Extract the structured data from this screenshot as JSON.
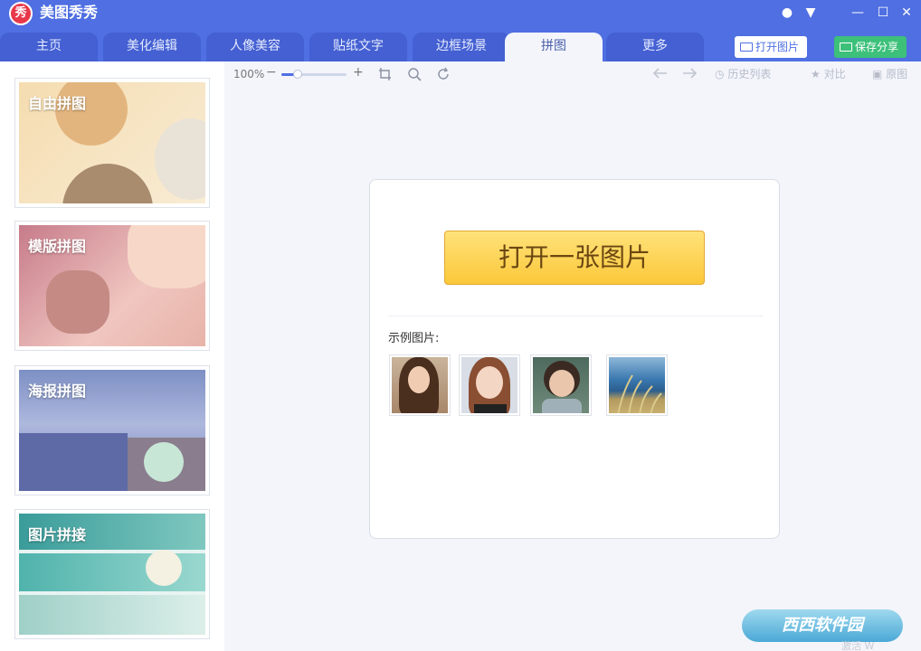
{
  "app": {
    "title": "美图秀秀",
    "logo_text": "秀"
  },
  "window_controls": {
    "chat": "●",
    "menu": "▼",
    "minimize": "—",
    "maximize": "☐",
    "close": "✕"
  },
  "tabs": [
    {
      "label": "主页"
    },
    {
      "label": "美化编辑"
    },
    {
      "label": "人像美容"
    },
    {
      "label": "贴纸文字"
    },
    {
      "label": "边框场景"
    },
    {
      "label": "拼图",
      "active": true
    },
    {
      "label": "更多"
    }
  ],
  "header_buttons": {
    "open_image": "打开图片",
    "save_share": "保存分享"
  },
  "sidebar": {
    "cards": [
      {
        "label": "自由拼图"
      },
      {
        "label": "模版拼图"
      },
      {
        "label": "海报拼图"
      },
      {
        "label": "图片拼接"
      }
    ]
  },
  "toolbar": {
    "zoom_level": "100%",
    "zoom_minus": "−",
    "zoom_plus": "+",
    "zoom_fraction": 0.25,
    "history_label": "历史列表",
    "compare_label": "对比",
    "original_label": "原图"
  },
  "main": {
    "open_button": "打开一张图片",
    "sample_label": "示例图片:",
    "samples": [
      "sample-1",
      "sample-2",
      "sample-3",
      "sample-4"
    ]
  },
  "watermark": {
    "text": "西西软件园",
    "sub": "激活 W"
  },
  "colors": {
    "brand": "#4f6fe2",
    "save_green": "#3cc07a",
    "open_yellow": "#fbc83a"
  }
}
